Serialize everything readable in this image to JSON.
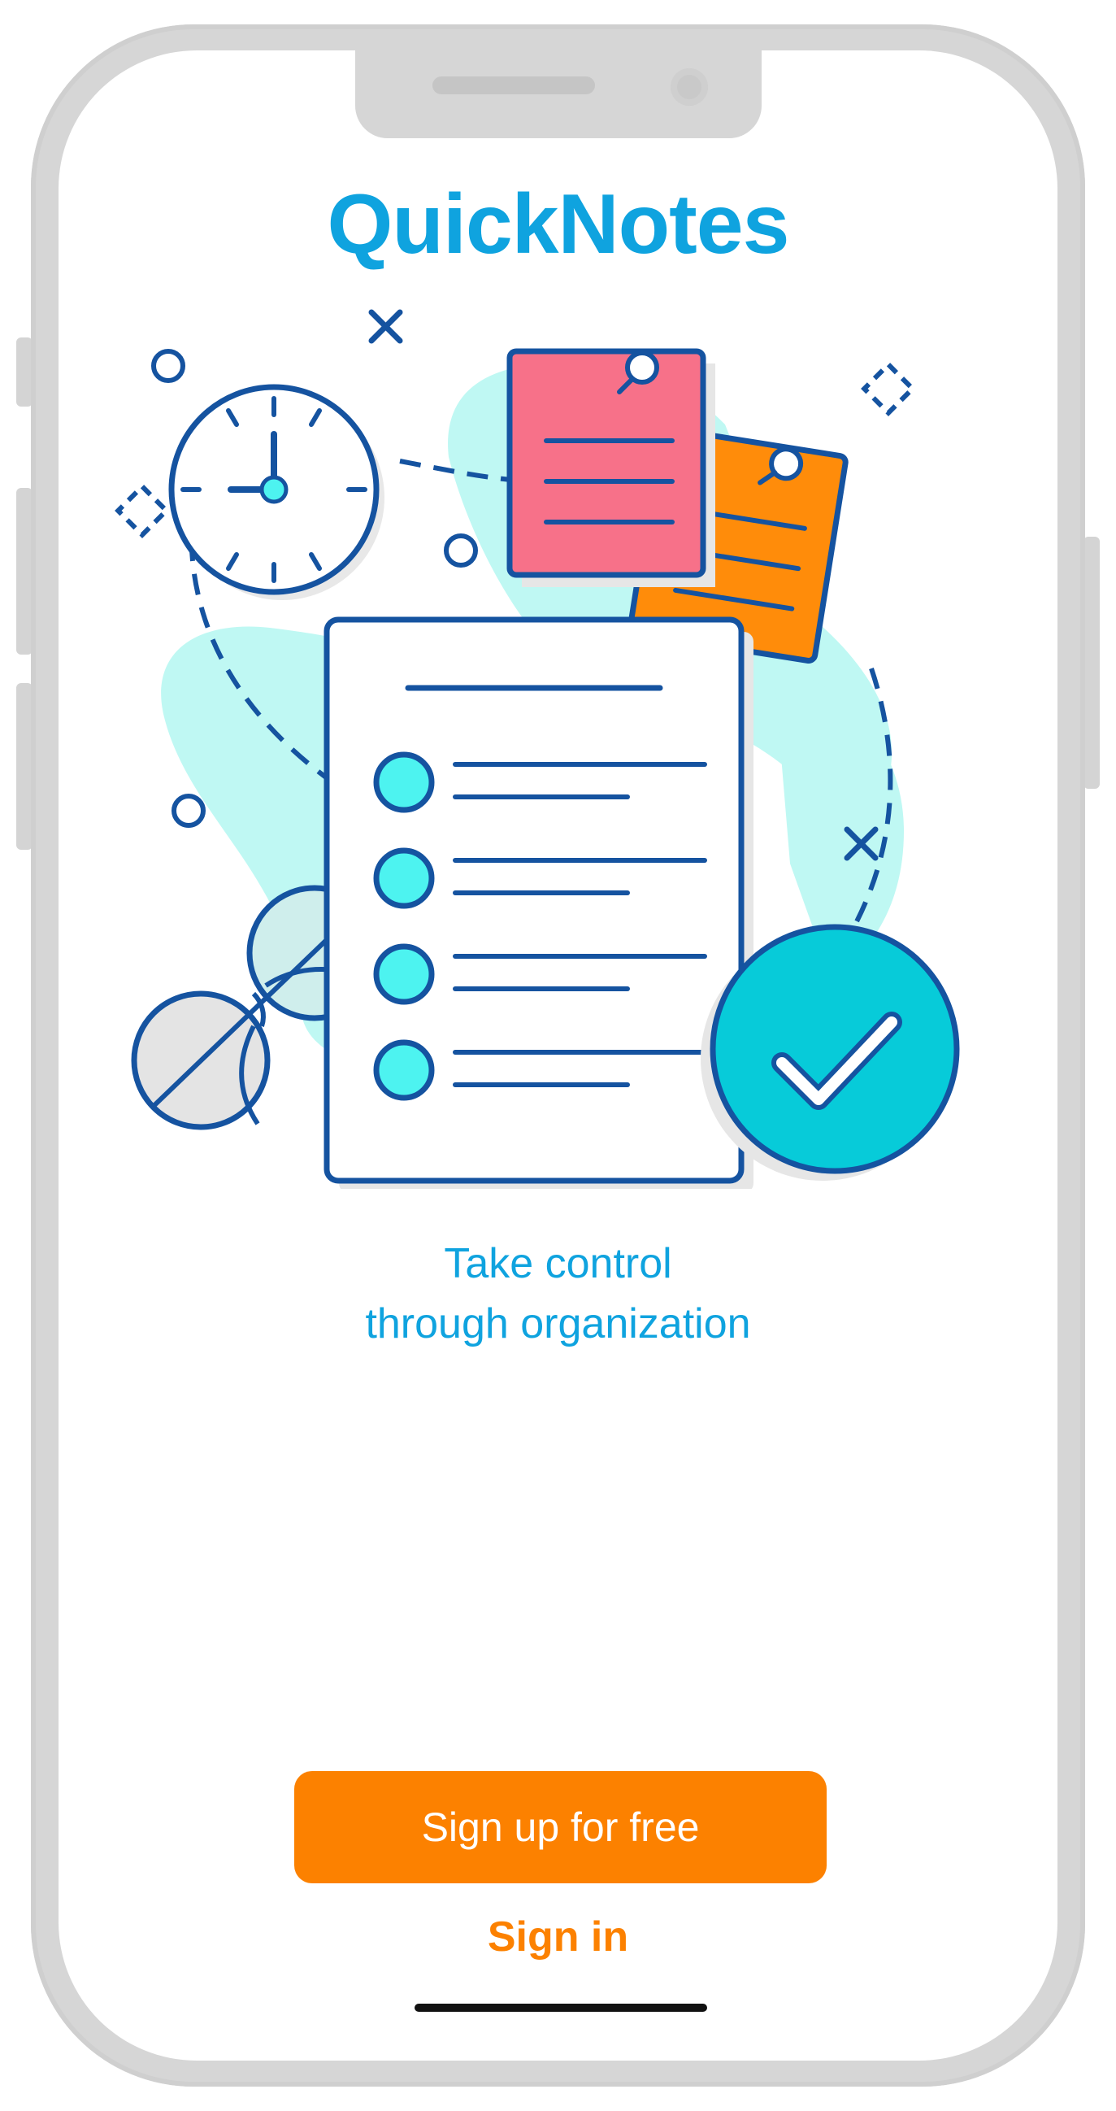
{
  "app": {
    "title": "QuickNotes"
  },
  "onboarding": {
    "tagline_line1": "Take control",
    "tagline_line2": "through organization"
  },
  "actions": {
    "signup_label": "Sign up for free",
    "signin_label": "Sign in"
  },
  "colors": {
    "brand_blue": "#0fa3df",
    "accent_orange": "#fc8100",
    "blob_cyan": "#bff8f3",
    "line_navy": "#1553a0",
    "note_pink": "#f77189",
    "note_orange": "#ff8c0a",
    "check_teal": "#07cbd9"
  },
  "icons": {
    "illustration": "checklist-with-clock-notes-and-glasses",
    "clock": "clock-icon",
    "check": "checkmark-icon"
  }
}
